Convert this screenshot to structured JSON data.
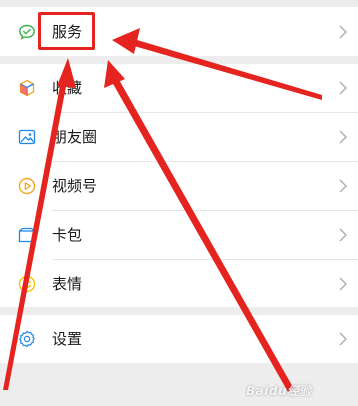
{
  "menu": {
    "items": [
      {
        "label": "服务",
        "icon": "service-icon"
      },
      {
        "label": "收藏",
        "icon": "favorites-icon"
      },
      {
        "label": "朋友圈",
        "icon": "moments-icon"
      },
      {
        "label": "视频号",
        "icon": "channels-icon"
      },
      {
        "label": "卡包",
        "icon": "card-wallet-icon"
      },
      {
        "label": "表情",
        "icon": "emoji-icon"
      },
      {
        "label": "设置",
        "icon": "settings-icon"
      }
    ]
  },
  "annotation": {
    "highlight_color": "#e5231f",
    "watermark_text": "Baidu经验"
  }
}
